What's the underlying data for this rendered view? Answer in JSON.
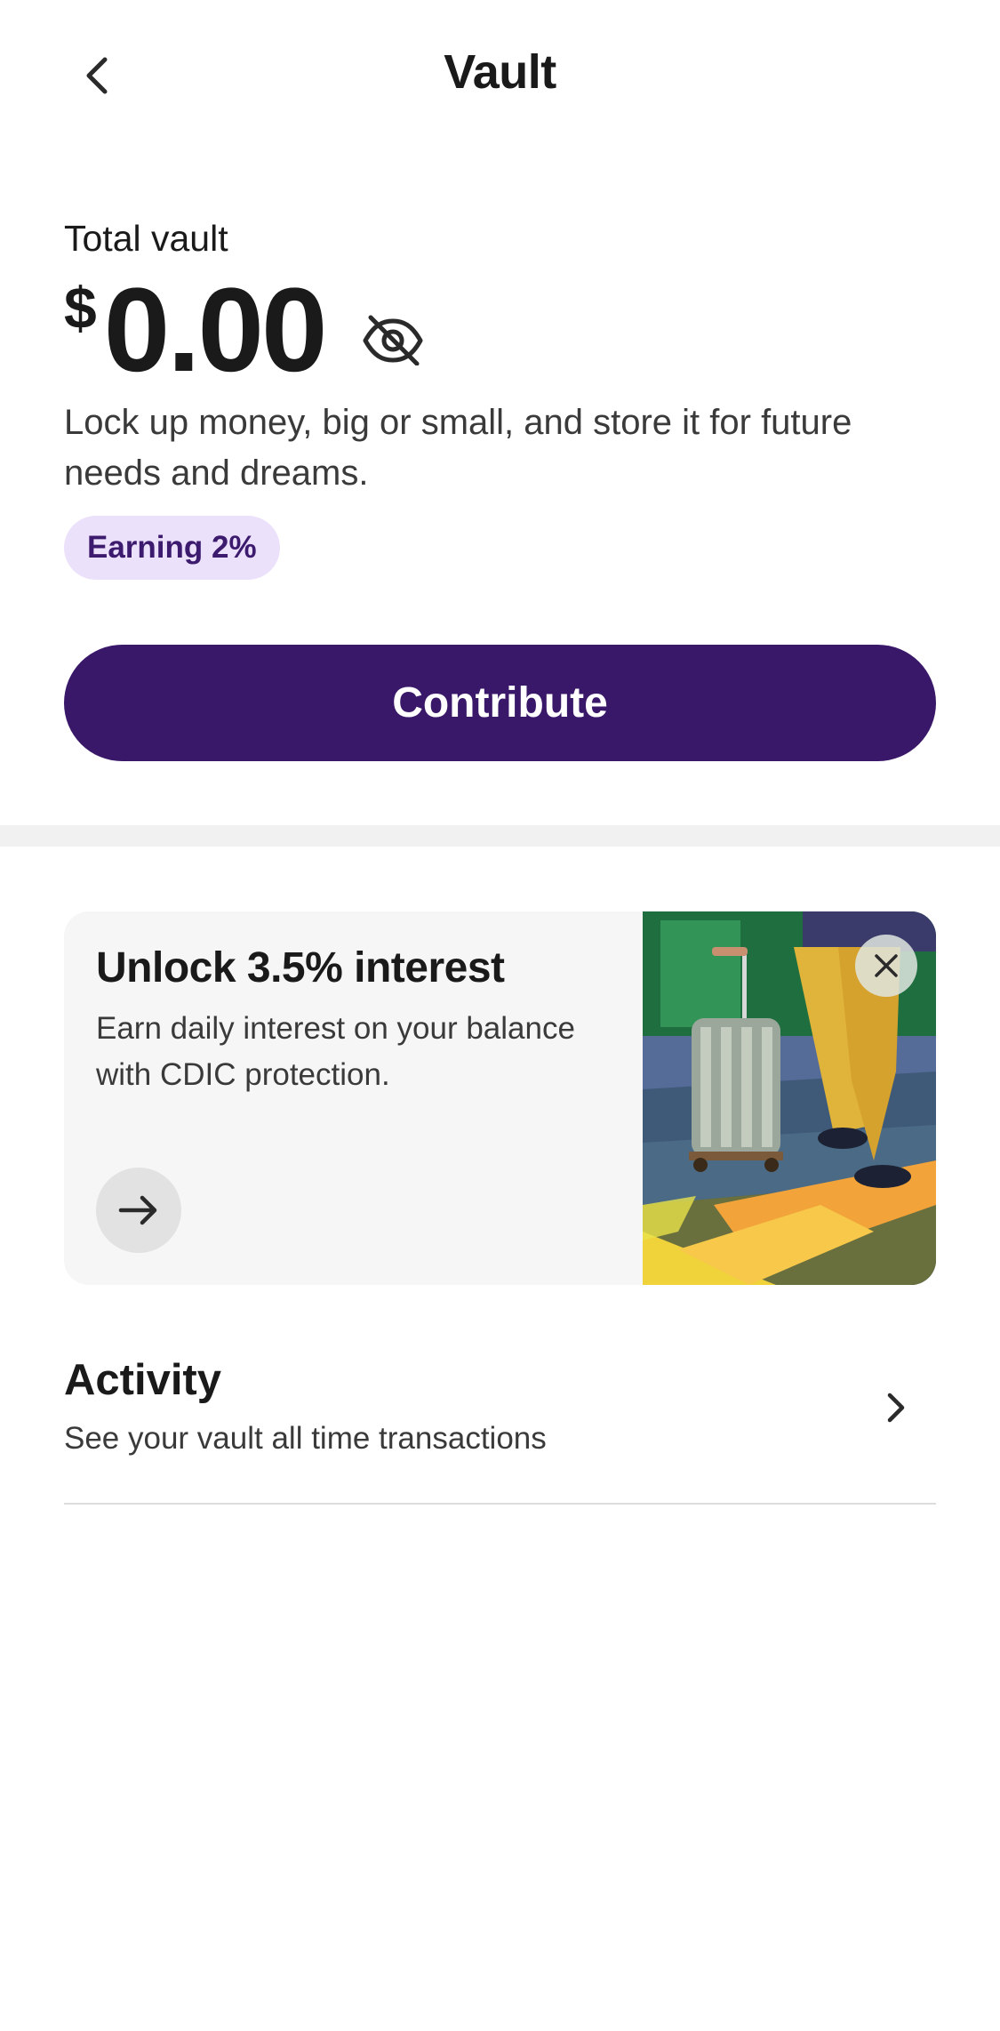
{
  "header": {
    "title": "Vault",
    "back_icon": "chevron-left-icon"
  },
  "balance": {
    "label": "Total vault",
    "currency": "$",
    "amount": "0.00",
    "visibility_icon": "eye-off-icon"
  },
  "description": "Lock up money, big or small, and store it for future needs and dreams.",
  "earning_badge": "Earning 2%",
  "contribute_button": "Contribute",
  "promo": {
    "title": "Unlock 3.5% interest",
    "text": "Earn daily interest on your balance with CDIC protection.",
    "arrow_icon": "arrow-right-icon",
    "close_icon": "close-icon",
    "image": "traveler-with-suitcase-illustration"
  },
  "activity": {
    "title": "Activity",
    "subtitle": "See your vault all time transactions",
    "chevron_icon": "chevron-right-icon"
  },
  "colors": {
    "primary": "#3a1869",
    "badge_bg": "#ece1fb",
    "badge_text": "#3c1a6e",
    "card_bg": "#f6f6f6"
  }
}
